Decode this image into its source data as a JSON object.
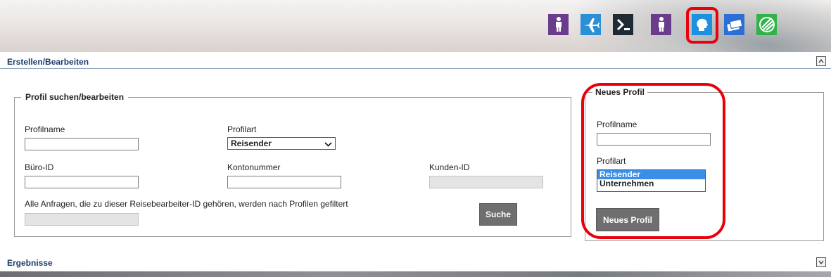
{
  "toolbar": {
    "icons": [
      {
        "name": "traveler-icon",
        "color": "#6a3d8c",
        "glyph": "person"
      },
      {
        "name": "plane-icon",
        "color": "#2b8fd6",
        "glyph": "plane"
      },
      {
        "name": "sigma-icon",
        "color": "#1f2b33",
        "glyph": "sigma"
      },
      {
        "name": "traveler-alt-icon",
        "color": "#6a3d8c",
        "glyph": "person"
      },
      {
        "name": "profile-head-icon",
        "color": "#1e90e0",
        "glyph": "head"
      },
      {
        "name": "cards-icon",
        "color": "#2b6fd6",
        "glyph": "cards"
      },
      {
        "name": "globe-icon",
        "color": "#2fb34a",
        "glyph": "globe"
      }
    ],
    "highlight_color": "#e8000b"
  },
  "section_edit": {
    "title": "Erstellen/Bearbeiten",
    "toggle": "^"
  },
  "search_panel": {
    "legend": "Profil suchen/bearbeiten",
    "profile_name_label": "Profilname",
    "profile_name_value": "",
    "profile_type_label": "Profilart",
    "profile_type_value": "Reisender",
    "office_id_label": "Büro-ID",
    "office_id_value": "",
    "account_number_label": "Kontonummer",
    "account_number_value": "",
    "customer_id_label": "Kunden-ID",
    "customer_id_value": "",
    "filter_note": "Alle Anfragen, die zu dieser Reisebearbeiter-ID gehören, werden nach Profilen gefiltert",
    "filter_value": "",
    "search_button": "Suche"
  },
  "new_profile_panel": {
    "legend": "Neues Profil",
    "profile_name_label": "Profilname",
    "profile_name_value": "",
    "profile_type_label": "Profilart",
    "profile_type_options": [
      "Reisender",
      "Unternehmen"
    ],
    "profile_type_selected": "Reisender",
    "create_button": "Neues Profil"
  },
  "section_results": {
    "title": "Ergebnisse",
    "toggle": "v"
  },
  "colors": {
    "section_title": "#1a3a6b",
    "button_gray": "#6f6f6f",
    "listbox_selected": "#3a8ee6"
  }
}
